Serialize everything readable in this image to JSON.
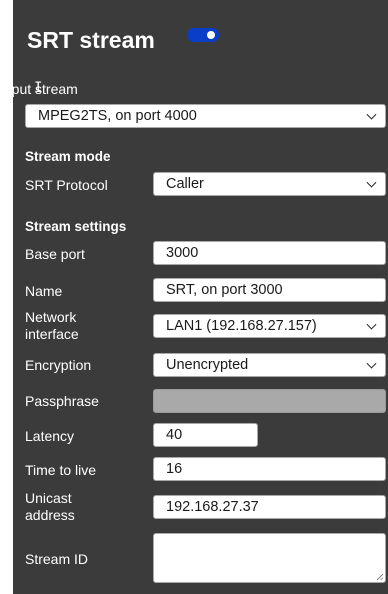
{
  "header": {
    "title": "SRT stream",
    "enabled": true,
    "accent": "#0a3ec8"
  },
  "input_stream": {
    "label": "Input stream",
    "value": "MPEG2TS, on port 4000"
  },
  "stream_mode": {
    "heading": "Stream mode",
    "srt_protocol": {
      "label": "SRT Protocol",
      "value": "Caller"
    }
  },
  "stream_settings": {
    "heading": "Stream settings",
    "base_port": {
      "label": "Base port",
      "value": "3000"
    },
    "name": {
      "label": "Name",
      "value": "SRT, on port 3000"
    },
    "network_interface": {
      "label_line1": "Network",
      "label_line2": "interface",
      "value": "LAN1 (192.168.27.157)"
    },
    "encryption": {
      "label": "Encryption",
      "value": "Unencrypted"
    },
    "passphrase": {
      "label": "Passphrase",
      "value": ""
    },
    "latency": {
      "label": "Latency",
      "value": "40"
    },
    "ttl": {
      "label": "Time to live",
      "value": "16"
    },
    "unicast": {
      "label_line1": "Unicast",
      "label_line2": "address",
      "value": "192.168.27.37"
    },
    "stream_id": {
      "label": "Stream ID",
      "value": ""
    }
  }
}
